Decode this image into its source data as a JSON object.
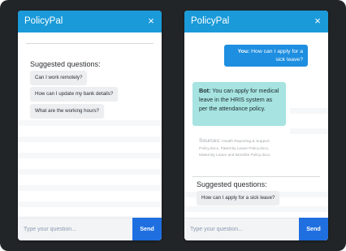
{
  "app": {
    "title": "PolicyPal",
    "close_glyph": "×"
  },
  "colors": {
    "header": "#1a9ad8",
    "send_button": "#1f6fe0",
    "user_bubble": "#1e8ee0",
    "bot_bubble": "#a6e3e1",
    "chip": "#eceef0"
  },
  "icons": {
    "close": "close-icon"
  },
  "left_panel": {
    "suggested_label": "Suggested questions:",
    "suggestions": [
      "Can I work remotely?",
      "How can I update my bank details?",
      "What are the working hours?"
    ],
    "input_placeholder": "Type your question...",
    "send_label": "Send"
  },
  "right_panel": {
    "user_message": {
      "who": "You:",
      "text": "How can I apply for a sick leave?"
    },
    "bot_message": {
      "who": "Bot:",
      "text": "You can apply for medical leave in the HRIS system as per the attendance policy."
    },
    "sources": {
      "label": "Sources:",
      "text": "Health Reporting & Support Policy.docx, Paternity Leave Policy.docx, Maternity Leave and Benefits Policy.docx"
    },
    "suggested_label": "Suggested questions:",
    "suggestions": [
      "How can I apply for a sick leave?"
    ],
    "input_placeholder": "Type your question...",
    "send_label": "Send"
  }
}
